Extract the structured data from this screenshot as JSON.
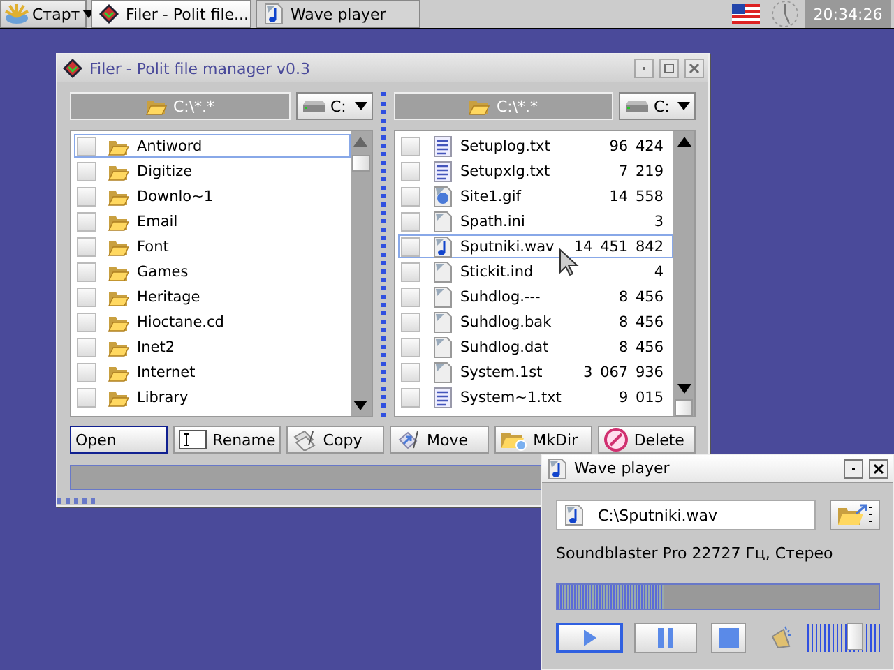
{
  "taskbar": {
    "start": "Старт",
    "tasks": [
      {
        "title": "Filer - Polit file...",
        "kind": "filer",
        "selected": true
      },
      {
        "title": "Wave player",
        "kind": "audio",
        "selected": false
      }
    ],
    "clock": "20:34:26"
  },
  "filer": {
    "title": "Filer - Polit file manager v0.3",
    "panels": [
      {
        "path": "C:\\*.*",
        "drive": "C:",
        "items": [
          {
            "name": "Antiword",
            "kind": "folder",
            "selected": true
          },
          {
            "name": "Digitize",
            "kind": "folder",
            "selected": false
          },
          {
            "name": "Downlo~1",
            "kind": "folder",
            "selected": false
          },
          {
            "name": "Email",
            "kind": "folder",
            "selected": false
          },
          {
            "name": "Font",
            "kind": "folder",
            "selected": false
          },
          {
            "name": "Games",
            "kind": "folder",
            "selected": false
          },
          {
            "name": "Heritage",
            "kind": "folder",
            "selected": false
          },
          {
            "name": "Hioctane.cd",
            "kind": "folder",
            "selected": false
          },
          {
            "name": "Inet2",
            "kind": "folder",
            "selected": false
          },
          {
            "name": "Internet",
            "kind": "folder",
            "selected": false
          },
          {
            "name": "Library",
            "kind": "folder",
            "selected": false
          }
        ]
      },
      {
        "path": "C:\\*.*",
        "drive": "C:",
        "items": [
          {
            "name": "Setuplog.txt",
            "size": "96 424",
            "kind": "text",
            "selected": false
          },
          {
            "name": "Setupxlg.txt",
            "size": "7 219",
            "kind": "text",
            "selected": false
          },
          {
            "name": "Site1.gif",
            "size": "14 558",
            "kind": "image",
            "selected": false
          },
          {
            "name": "Spath.ini",
            "size": "3",
            "kind": "file",
            "selected": false
          },
          {
            "name": "Sputniki.wav",
            "size": "14 451 842",
            "kind": "audio",
            "selected": true
          },
          {
            "name": "Stickit.ind",
            "size": "4",
            "kind": "file",
            "selected": false
          },
          {
            "name": "Suhdlog.---",
            "size": "8 456",
            "kind": "file",
            "selected": false
          },
          {
            "name": "Suhdlog.bak",
            "size": "8 456",
            "kind": "file",
            "selected": false
          },
          {
            "name": "Suhdlog.dat",
            "size": "8 456",
            "kind": "file",
            "selected": false
          },
          {
            "name": "System.1st",
            "size": "3 067 936",
            "kind": "file",
            "selected": false
          },
          {
            "name": "System~1.txt",
            "size": "9 015",
            "kind": "text",
            "selected": false
          }
        ]
      }
    ],
    "buttons": [
      {
        "label": "Open",
        "kind": "open",
        "focused": true
      },
      {
        "label": "Rename",
        "kind": "rename",
        "focused": false
      },
      {
        "label": "Copy",
        "kind": "copy",
        "focused": false
      },
      {
        "label": "Move",
        "kind": "move",
        "focused": false
      },
      {
        "label": "MkDir",
        "kind": "mkdir",
        "focused": false
      },
      {
        "label": "Delete",
        "kind": "delete",
        "focused": false
      }
    ]
  },
  "player": {
    "title": "Wave player",
    "file": "C:\\Sputniki.wav",
    "info": "Soundblaster Pro 22727 Гц, Стерео",
    "progress": {
      "level": 0.33
    },
    "volume": {
      "level": 0.65
    },
    "controls": [
      {
        "kind": "play",
        "focused": true
      },
      {
        "kind": "pause",
        "focused": false
      },
      {
        "kind": "stop",
        "focused": false
      }
    ]
  }
}
